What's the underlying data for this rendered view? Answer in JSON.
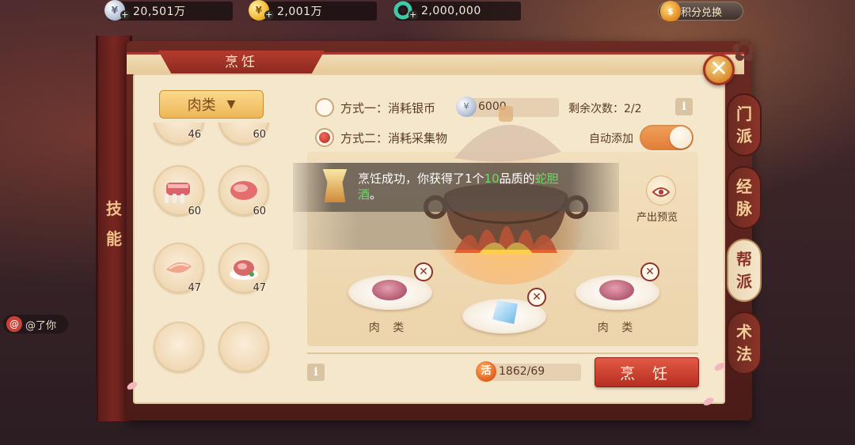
{
  "currency": {
    "silver": "20,501万",
    "gold": "2,001万",
    "jade": "2,000,000",
    "points_label": "积分兑换"
  },
  "panel": {
    "title": "烹饪",
    "left_scroll_label": "技能",
    "side_tabs": [
      "门派",
      "经脉",
      "帮派",
      "术法"
    ],
    "active_side_tab": "帮派"
  },
  "ingredients": {
    "category": "肉类",
    "slots": [
      {
        "count": "46"
      },
      {
        "count": "60"
      },
      {
        "count": "60"
      },
      {
        "count": "60"
      },
      {
        "count": "47"
      },
      {
        "count": "47"
      },
      {
        "count": ""
      },
      {
        "count": ""
      }
    ]
  },
  "methods": {
    "method1_label": "方式一：消耗银币",
    "method1_cost": "6000",
    "remaining_label": "剩余次数：2/2",
    "method2_label": "方式二：消耗采集物",
    "auto_add_label": "自动添加",
    "auto_add_on": true,
    "selected": 2
  },
  "toast": {
    "prefix": "烹饪成功，你获得了1个",
    "quality": "10",
    "middle": "品质的",
    "item": "蛇胆",
    "item_tail": "酒",
    "suffix": "。"
  },
  "cooking": {
    "preview_label": "产出预览",
    "plates": [
      {
        "label": "肉 类",
        "food": "meat"
      },
      {
        "label": "",
        "food": "ice"
      },
      {
        "label": "肉 类",
        "food": "meat"
      }
    ]
  },
  "bottom": {
    "energy_icon_label": "活",
    "energy": "1862/69",
    "cook_button": "烹 饪"
  },
  "chat": {
    "hint": "@了你",
    "at_symbol": "@"
  },
  "colors": {
    "accent_red": "#b52e22",
    "panel_bg": "#f5e7cc",
    "highlight_green": "#6fd86a"
  }
}
